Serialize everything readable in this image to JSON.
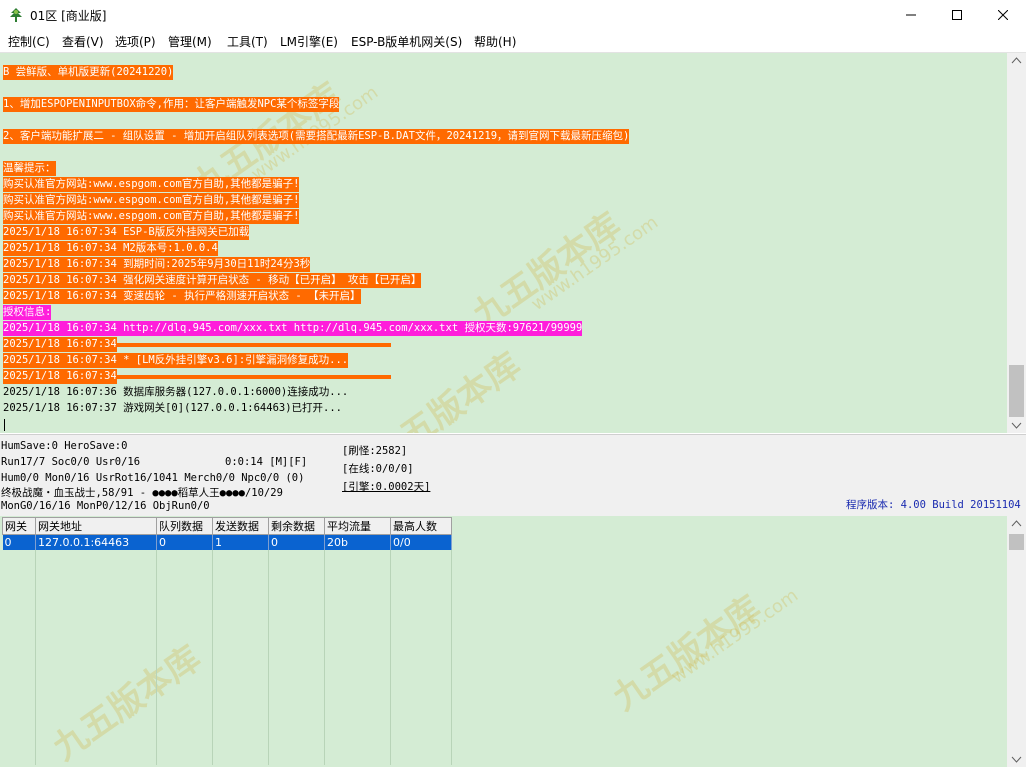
{
  "window": {
    "title": "01区 [商业版]",
    "controls": [
      "minimize",
      "maximize",
      "close"
    ]
  },
  "menu": [
    "控制(C)",
    "查看(V)",
    "选项(P)",
    "管理(M)",
    "工具(T)",
    "LM引擎(E)",
    "ESP-B版单机网关(S)",
    "帮助(H)"
  ],
  "log": {
    "lines": [
      {
        "text": "B 尝鲜版、单机版更新(20241220)",
        "style": "orange"
      },
      {
        "text": "1、增加ESPOPENINPUTBOX命令,作用：让客户端触发NPC某个标签字段",
        "style": "orange"
      },
      {
        "text": "2、客户端功能扩展二 - 组队设置 - 增加开启组队列表选项(需要搭配最新ESP-B.DAT文件，20241219，请到官网下载最新压缩包)",
        "style": "orange"
      },
      {
        "text": "温馨提示：",
        "style": "orange"
      },
      {
        "text": "购买认准官方网站:www.espgom.com官方自助,其他都是骗子!",
        "style": "orange"
      },
      {
        "text": "购买认准官方网站:www.espgom.com官方自助,其他都是骗子!",
        "style": "orange"
      },
      {
        "text": "购买认准官方网站:www.espgom.com官方自助,其他都是骗子!",
        "style": "orange"
      },
      {
        "text": "2025/1/18 16:07:34 ESP-B版反外挂网关已加载",
        "style": "orange"
      },
      {
        "text": "2025/1/18 16:07:34 M2版本号:1.0.0.4",
        "style": "orange"
      },
      {
        "text": "2025/1/18 16:07:34 到期时间:2025年9月30日11时24分3秒",
        "style": "orange"
      },
      {
        "text": "2025/1/18 16:07:34 强化网关速度计算开启状态 - 移动【已开启】 攻击【已开启】",
        "style": "orange"
      },
      {
        "text": "2025/1/18 16:07:34 变速齿轮 - 执行严格测速开启状态 - 【未开启】",
        "style": "orange"
      },
      {
        "text": "授权信息:",
        "style": "magenta"
      },
      {
        "text": "2025/1/18 16:07:34 http://dlq.945.com/xxx.txt http://dlq.945.com/xxx.txt 授权天数:97621/99999",
        "style": "magenta"
      },
      {
        "text": "2025/1/18 16:07:34",
        "style": "orange"
      },
      {
        "text": "2025/1/18 16:07:34 * [LM反外挂引擎v3.6]:引擎漏洞修复成功...",
        "style": "orange"
      },
      {
        "text": "2025/1/18 16:07:34",
        "style": "orange"
      },
      {
        "text": "2025/1/18 16:07:36 数据库服务器(127.0.0.1:6000)连接成功...",
        "style": "plain"
      },
      {
        "text": "2025/1/18 16:07:37 游戏网关[0](127.0.0.1:64463)已打开...",
        "style": "plain"
      }
    ]
  },
  "status": {
    "line1": "HumSave:0 HeroSave:0",
    "line2": "Run17/7 Soc0/0 Usr0/16",
    "line2_timer": "0:0:14 [M][F]",
    "line3": "Hum0/0 Mon0/16 UsrRot16/1041 Merch0/0 Npc0/0 (0)",
    "line4": "终极战魔・血玉战士,58/91 - ●●●●稻草人王●●●●/10/29",
    "line5": "MonG0/16/16 MonP0/12/16 ObjRun0/0",
    "refresh": "[刷怪:2582]",
    "online": "[在线:0/0/0]",
    "engine": "[引擎:0.0002天]",
    "version": "程序版本: 4.00 Build 20151104"
  },
  "gateway_table": {
    "headers": [
      "网关",
      "网关地址",
      "队列数据",
      "发送数据",
      "剩余数据",
      "平均流量",
      "最高人数"
    ],
    "rows": [
      [
        "0",
        "127.0.0.1:64463",
        "0",
        "1",
        "0",
        "20b",
        "0/0"
      ]
    ]
  },
  "watermark": {
    "text": "九五版本库",
    "url": "www.h1995.com"
  },
  "colors": {
    "log_bg": "#d4ecd4",
    "highlight_orange": "#ff6a00",
    "highlight_magenta": "#ff1edb",
    "selection_blue": "#0a63d0",
    "version_text": "#1a2bb0"
  }
}
